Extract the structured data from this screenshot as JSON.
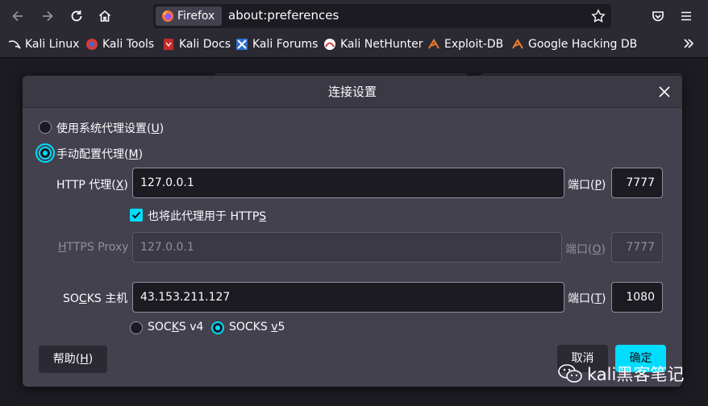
{
  "browser": {
    "identity_label": "Firefox",
    "url": "about:preferences"
  },
  "bookmarks": [
    {
      "label": "Kali Linux"
    },
    {
      "label": "Kali Tools"
    },
    {
      "label": "Kali Docs"
    },
    {
      "label": "Kali Forums"
    },
    {
      "label": "Kali NetHunter"
    },
    {
      "label": "Exploit-DB"
    },
    {
      "label": "Google Hacking DB"
    }
  ],
  "dialog": {
    "title": "连接设置",
    "system_proxy": {
      "text": "使用系统代理设置(",
      "key": "U",
      "close": ")"
    },
    "manual_proxy": {
      "text": "手动配置代理(",
      "key": "M",
      "close": ")"
    },
    "http": {
      "label_pre": "HTTP 代理(",
      "label_key": "X",
      "label_post": ")",
      "value": "127.0.0.1",
      "port_pre": "端口(",
      "port_key": "P",
      "port_post": ")",
      "port": "7777"
    },
    "also_https": {
      "text": "也将此代理用于 HTTP",
      "key": "S",
      "checked": true
    },
    "https": {
      "label_pre": "",
      "label_key": "H",
      "label_post": "TTPS Proxy",
      "value": "127.0.0.1",
      "port_pre": "端口(",
      "port_key": "O",
      "port_post": ")",
      "port": "7777"
    },
    "socks": {
      "label_pre": "SO",
      "label_key": "C",
      "label_post": "KS 主机",
      "value": "43.153.211.127",
      "port_pre": "端口(",
      "port_key": "T",
      "port_post": ")",
      "port": "1080"
    },
    "socks_v4": {
      "pre": "SOC",
      "key": "K",
      "post": "S v4"
    },
    "socks_v5": {
      "pre": "SOCKS ",
      "key": "v",
      "post": "5"
    },
    "help": {
      "pre": "帮助(",
      "key": "H",
      "post": ")"
    },
    "cancel": "取消",
    "ok": "确定"
  },
  "watermark": "kali黑客笔记",
  "colors": {
    "accent": "#00ddff",
    "dialog": "#42414d",
    "toolbar": "#2b2a33"
  }
}
